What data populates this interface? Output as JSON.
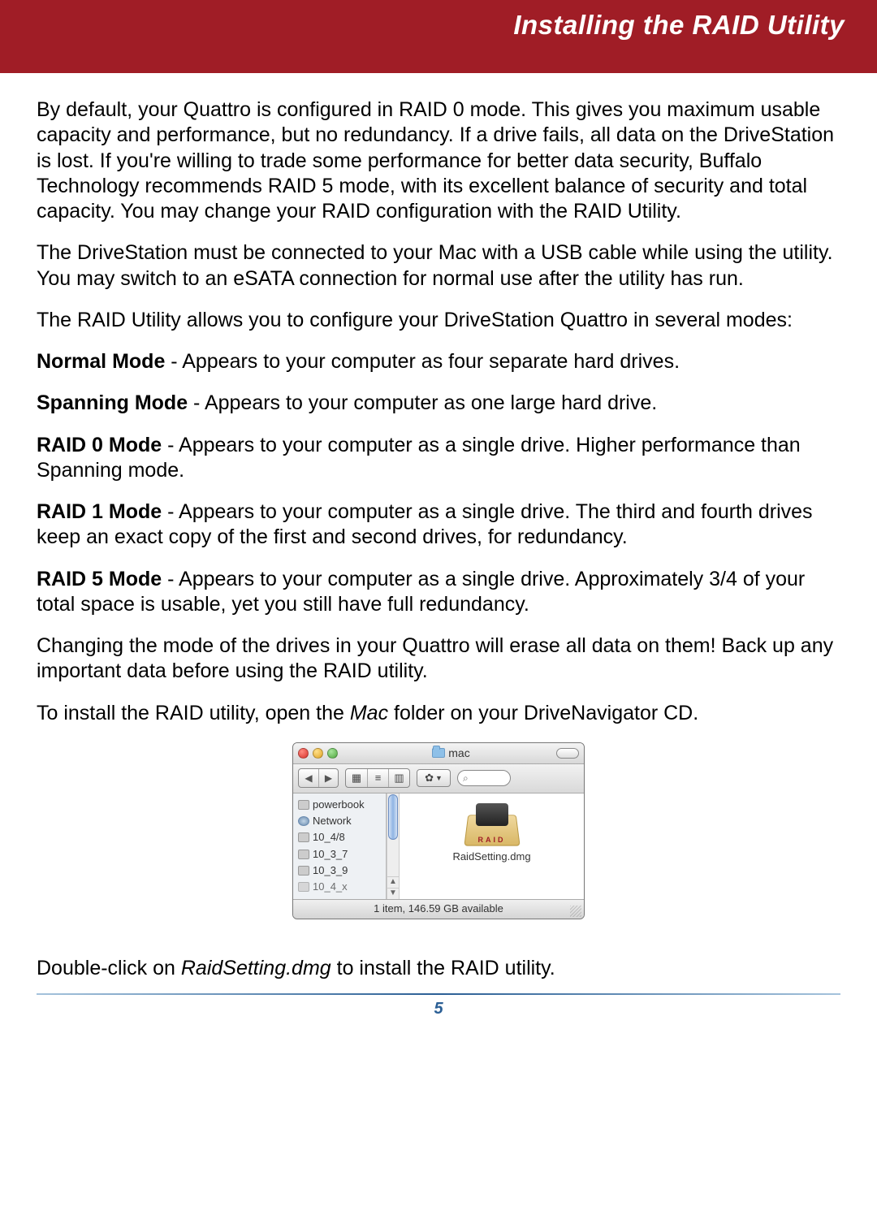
{
  "header": {
    "title": "Installing the RAID Utility"
  },
  "body": {
    "p1": "By default, your Quattro is configured in RAID 0 mode.  This gives you maximum usable capacity and performance, but no redundancy.  If a drive fails, all data on the DriveStation is lost.  If you're willing to trade some performance for better data security, Buffalo Technology recommends RAID 5 mode, with its excellent balance of security and total capacity.  You may change your RAID configuration with the RAID Utility.",
    "p2": "The DriveStation must be connected to your Mac with a USB cable while using the utility. You may switch to an eSATA connection for normal use after the utility has run.",
    "p3": "The RAID Utility allows you to configure your DriveStation Quattro in several modes:",
    "modes": [
      {
        "name": "Normal Mode",
        "desc": " - Appears to your computer as four separate hard drives."
      },
      {
        "name": "Spanning Mode",
        "desc": " - Appears to your computer as one large hard drive."
      },
      {
        "name": "RAID 0 Mode",
        "desc": " - Appears to your computer as a single drive.  Higher performance than Spanning mode."
      },
      {
        "name": "RAID 1 Mode",
        "desc": " - Appears to your computer as a single drive.  The third and fourth drives keep an exact copy of the first and second drives, for redundancy."
      },
      {
        "name": "RAID 5 Mode",
        "desc": " - Appears to your computer as a single drive.  Approximately 3/4 of your total space is usable, yet you still have full redundancy."
      }
    ],
    "p4": "Changing the mode of the drives in your Quattro will erase all data on them!  Back up any important data before using the RAID utility.",
    "install_pre": "To install the RAID utility, open the ",
    "install_em": "Mac",
    "install_post": " folder on your DriveNavigator CD.",
    "double_pre": "Double-click on ",
    "double_em": "RaidSetting.dmg",
    "double_post": " to install the RAID utility."
  },
  "finder": {
    "title": "mac",
    "sidebar": [
      "powerbook",
      "Network",
      "10_4/8",
      "10_3_7",
      "10_3_9",
      "10_4_x"
    ],
    "file": "RaidSetting.dmg",
    "raid_tag": "RAID",
    "status": "1 item, 146.59 GB available"
  },
  "page_number": "5"
}
